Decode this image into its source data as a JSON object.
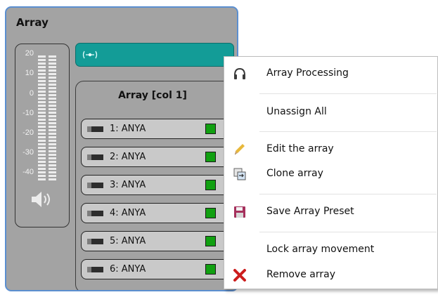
{
  "panel": {
    "title": "Array",
    "meter_scale": [
      "20",
      "10",
      "0",
      "-10",
      "-20",
      "-30",
      "-40"
    ],
    "column_title": "Array [col 1]",
    "channels": [
      {
        "label": "1: ANYA"
      },
      {
        "label": "2: ANYA"
      },
      {
        "label": "3: ANYA"
      },
      {
        "label": "4: ANYA"
      },
      {
        "label": "5: ANYA"
      },
      {
        "label": "6: ANYA"
      }
    ]
  },
  "context_menu": {
    "items": [
      {
        "label": "Array Processing",
        "icon": "headphones-icon"
      },
      {
        "label": "Unassign All",
        "icon": ""
      },
      {
        "label": "Edit the array",
        "icon": "pencil-icon"
      },
      {
        "label": "Clone array",
        "icon": "clone-icon"
      },
      {
        "label": "Save Array Preset",
        "icon": "save-icon"
      },
      {
        "label": "Lock array movement",
        "icon": ""
      },
      {
        "label": "Remove array",
        "icon": "remove-icon"
      }
    ]
  },
  "colors": {
    "panel_bg": "#a3a3a3",
    "panel_border": "#5b8fd0",
    "cyan_bar": "#139c97",
    "led_green": "#11a011",
    "remove_red": "#cc1d1d",
    "save_magenta": "#a5305c"
  }
}
